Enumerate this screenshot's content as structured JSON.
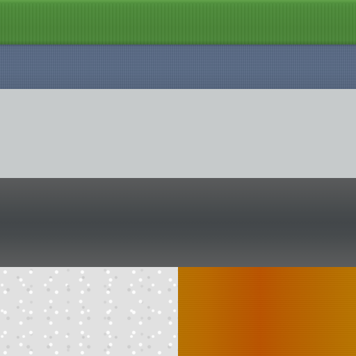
{
  "texture_atlas": {
    "tiles": [
      {
        "name": "grass",
        "color": "#4c8a39"
      },
      {
        "name": "water",
        "color": "#5a6b86"
      },
      {
        "name": "concrete",
        "color": "#c6cacb"
      },
      {
        "name": "asphalt",
        "color": "#474b4d"
      },
      {
        "name": "snow",
        "color": "#e1e1e1"
      },
      {
        "name": "rust",
        "color": "#bb5400"
      }
    ]
  }
}
